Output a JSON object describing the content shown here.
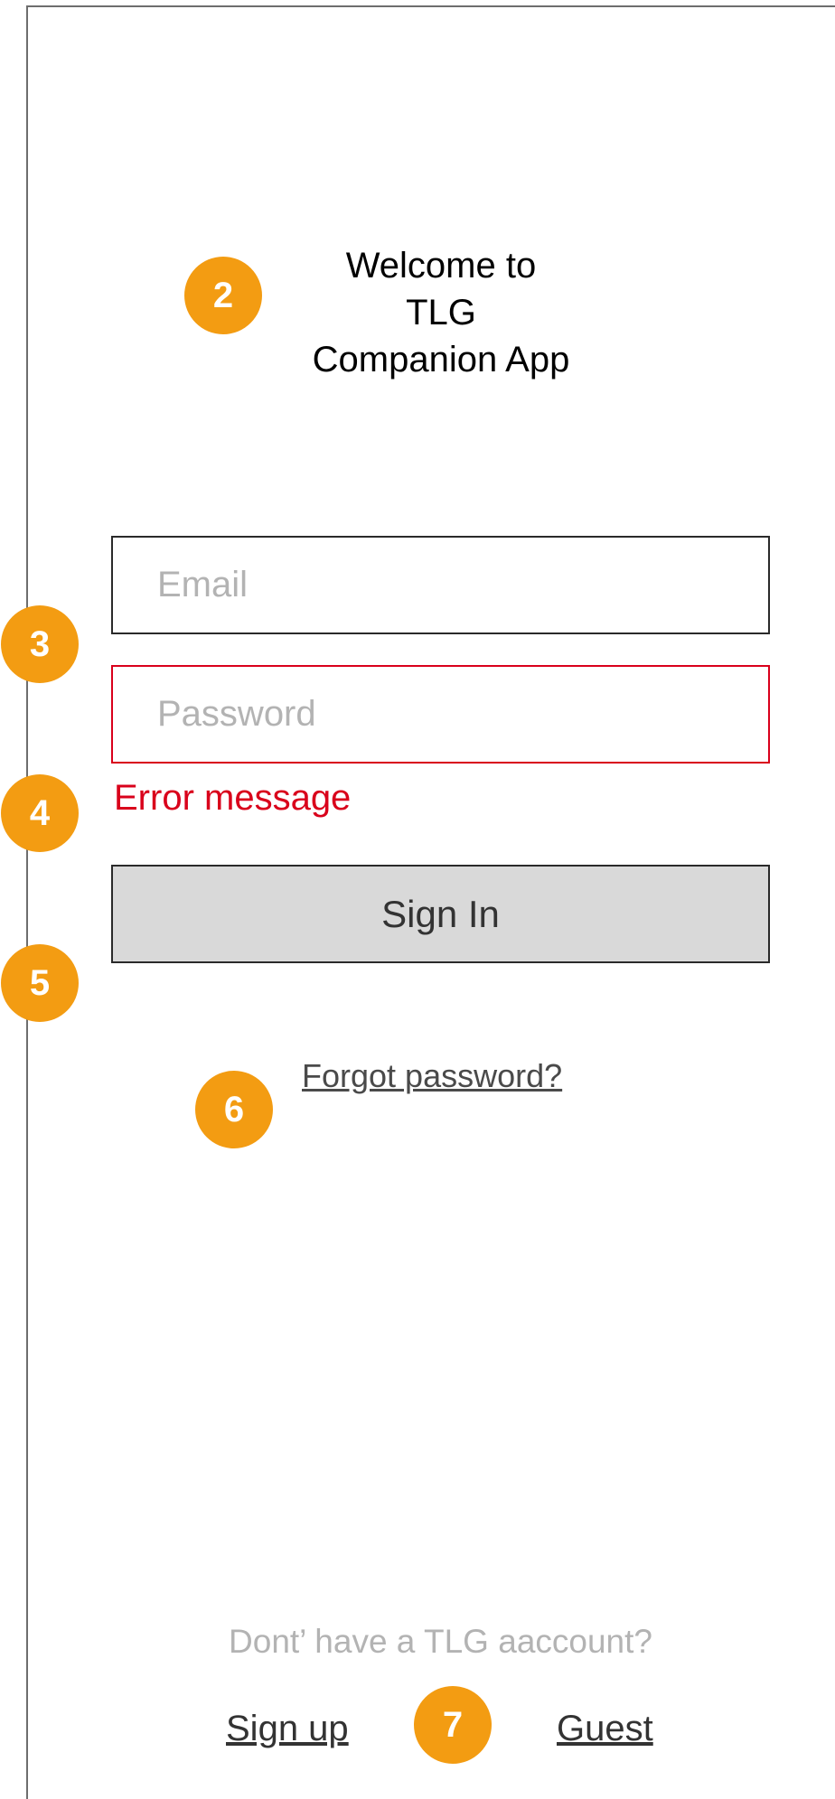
{
  "welcome": {
    "line1": "Welcome to",
    "line2": "TLG",
    "line3": "Companion App"
  },
  "form": {
    "email_placeholder": "Email",
    "password_placeholder": "Password",
    "error_message": "Error message",
    "signin_label": "Sign In",
    "forgot_label": "Forgot password?"
  },
  "footer": {
    "no_account_text": "Dont’ have a TLG aaccount?",
    "signup_label": "Sign up",
    "guest_label": "Guest"
  },
  "annotations": {
    "m2": "2",
    "m3": "3",
    "m4": "4",
    "m5": "5",
    "m6": "6",
    "m7": "7"
  },
  "colors": {
    "error": "#d9001b",
    "marker": "#f39c12",
    "button_bg": "#d9d9d9",
    "placeholder": "#b3b3b3"
  }
}
